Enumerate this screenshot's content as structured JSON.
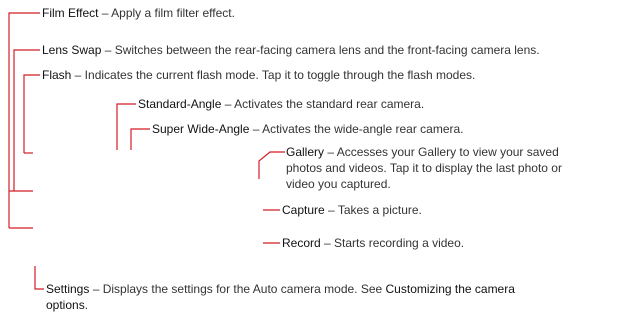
{
  "colors": {
    "callout_line": "#d21f26",
    "text": "#333333"
  },
  "items": {
    "film_effect": {
      "term": "Film Effect",
      "desc": " – Apply a film filter effect."
    },
    "lens_swap": {
      "term": "Lens Swap",
      "desc": " – Switches between the rear-facing camera lens and the front-facing camera lens."
    },
    "flash": {
      "term": "Flash",
      "desc": " – Indicates the current flash mode. Tap it to toggle through the flash modes."
    },
    "standard_angle": {
      "term": "Standard-Angle",
      "desc": " – Activates the standard rear camera."
    },
    "super_wide": {
      "term": "Super Wide-Angle",
      "desc": " – Activates the wide-angle rear camera."
    },
    "gallery": {
      "term": "Gallery",
      "line1": " – Accesses your Gallery to view your saved",
      "line2": "photos and videos. Tap it to display the last photo or",
      "line3": "video you captured."
    },
    "capture": {
      "term": "Capture",
      "desc": " – Takes a picture."
    },
    "record": {
      "term": "Record",
      "desc": " – Starts recording a video."
    },
    "settings": {
      "term": "Settings",
      "desc": " – Displays the settings for the Auto camera mode. See ",
      "link": "Customizing the camera",
      "link2": "options",
      "tail": "."
    }
  }
}
